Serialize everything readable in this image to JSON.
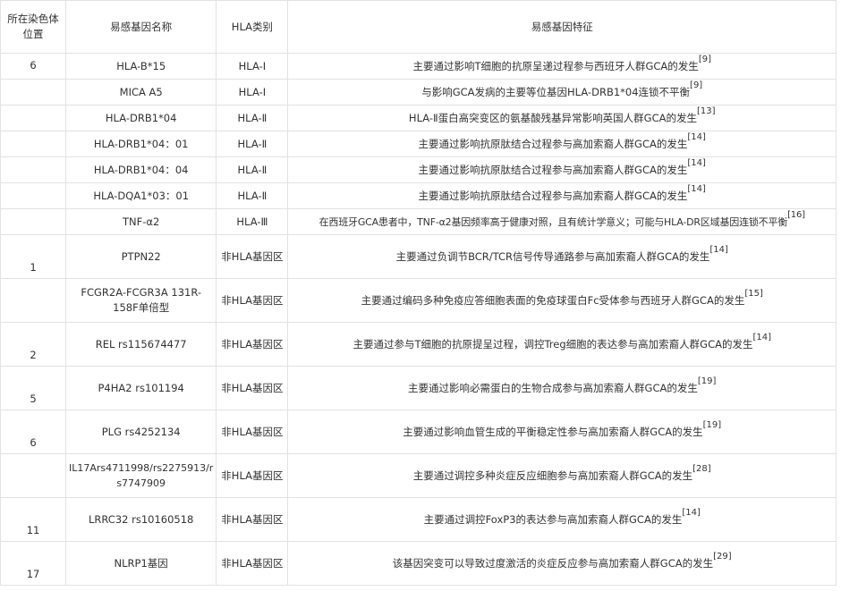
{
  "table": {
    "headers": [
      "所在染色体位置",
      "易感基因名称",
      "HLA类别",
      "易感基因特征"
    ],
    "rows": [
      {
        "chrom": "6",
        "gene": "HLA-B*15",
        "cls": "HLA-Ⅰ",
        "feature": "主要通过影响T细胞的抗原呈递过程参与西班牙人群GCA的发生",
        "ref": "[9]"
      },
      {
        "chrom": "",
        "gene": "MICA A5",
        "cls": "HLA-Ⅰ",
        "feature": "与影响GCA发病的主要等位基因HLA-DRB1*04连锁不平衡",
        "ref": "[9]"
      },
      {
        "chrom": "",
        "gene": "HLA-DRB1*04",
        "cls": "HLA-Ⅱ",
        "feature": "HLA-Ⅱ蛋白高突变区的氨基酸残基异常影响英国人群GCA的发生",
        "ref": "[13]"
      },
      {
        "chrom": "",
        "gene": "HLA-DRB1*04：01",
        "cls": "HLA-Ⅱ",
        "feature": "主要通过影响抗原肽结合过程参与高加索裔人群GCA的发生",
        "ref": "[14]"
      },
      {
        "chrom": "",
        "gene": "HLA-DRB1*04：04",
        "cls": "HLA-Ⅱ",
        "feature": "主要通过影响抗原肽结合过程参与高加索裔人群GCA的发生",
        "ref": "[14]"
      },
      {
        "chrom": "",
        "gene": "HLA-DQA1*03：01",
        "cls": "HLA-Ⅱ",
        "feature": "主要通过影响抗原肽结合过程参与高加索裔人群GCA的发生",
        "ref": "[14]"
      },
      {
        "chrom": "",
        "gene": "TNF-α2",
        "cls": "HLA-Ⅲ",
        "feature": "在西班牙GCA患者中，TNF-α2基因频率高于健康对照，且有统计学意义；可能与HLA-DR区域基因连锁不平衡",
        "ref": "[16]"
      },
      {
        "chrom": "1",
        "gene": "PTPN22",
        "cls": "非HLA基因区",
        "feature": "主要通过负调节BCR/TCR信号传导通路参与高加索裔人群GCA的发生",
        "ref": "[14]"
      },
      {
        "chrom": "",
        "gene": "FCGR2A-FCGR3A 131R-158F单倍型",
        "cls": "非HLA基因区",
        "feature": "主要通过编码多种免疫应答细胞表面的免疫球蛋白Fc受体参与西班牙人群GCA的发生",
        "ref": "[15]"
      },
      {
        "chrom": "2",
        "gene": "REL rs115674477",
        "cls": "非HLA基因区",
        "feature": "主要通过参与T细胞的抗原提呈过程，调控Treg细胞的表达参与高加索裔人群GCA的发生",
        "ref": "[14]"
      },
      {
        "chrom": "5",
        "gene": "P4HA2 rs101194",
        "cls": "非HLA基因区",
        "feature": "主要通过影响必需蛋白的生物合成参与高加索裔人群GCA的发生",
        "ref": "[19]"
      },
      {
        "chrom": "6",
        "gene": "PLG rs4252134",
        "cls": "非HLA基因区",
        "feature": "主要通过影响血管生成的平衡稳定性参与高加索裔人群GCA的发生",
        "ref": "[19]"
      },
      {
        "chrom": "",
        "gene": "IL17Ars4711998/rs2275913/rs7747909",
        "cls": "非HLA基因区",
        "feature": "主要通过调控多种炎症反应细胞参与高加索裔人群GCA的发生",
        "ref": "[28]"
      },
      {
        "chrom": "11",
        "gene": "LRRC32 rs10160518",
        "cls": "非HLA基因区",
        "feature": "主要通过调控FoxP3的表达参与高加索裔人群GCA的发生",
        "ref": "[14]"
      },
      {
        "chrom": "17",
        "gene": "NLRP1基因",
        "cls": "非HLA基因区",
        "feature": "该基因突变可以导致过度激活的炎症反应参与高加索裔人群GCA的发生",
        "ref": "[29]"
      }
    ]
  }
}
